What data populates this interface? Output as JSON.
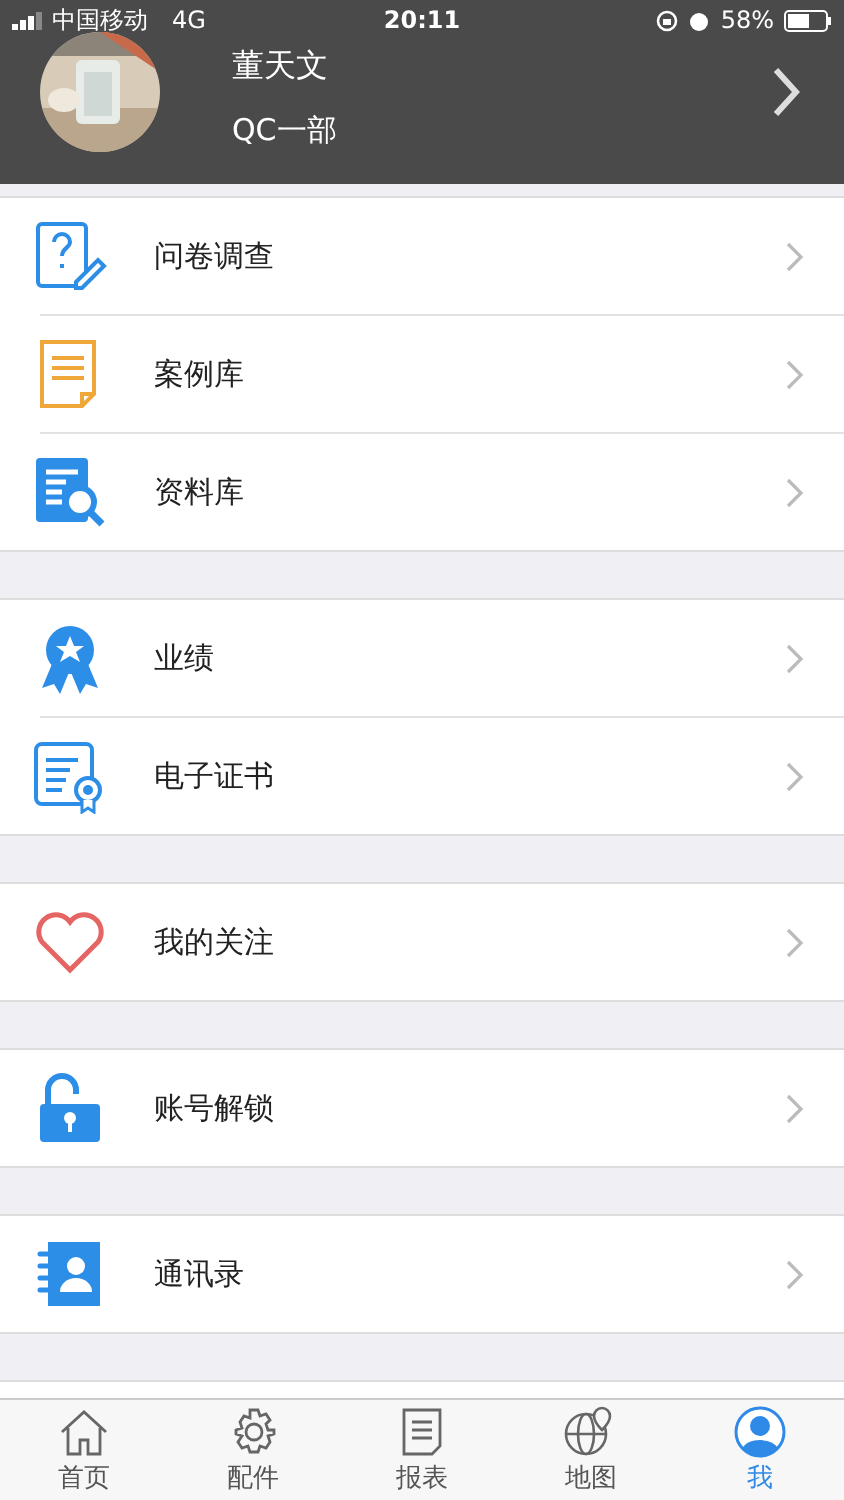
{
  "status_bar": {
    "carrier": "中国移动",
    "network": "4G",
    "time": "20:11",
    "battery": "58%"
  },
  "profile": {
    "name": "董天文",
    "department": "QC一部"
  },
  "groups": [
    {
      "items": [
        {
          "label": "问卷调查",
          "kind": "survey"
        },
        {
          "label": "案例库",
          "kind": "document"
        },
        {
          "label": "资料库",
          "kind": "search"
        }
      ]
    },
    {
      "items": [
        {
          "label": "业绩",
          "kind": "award"
        },
        {
          "label": "电子证书",
          "kind": "certificate"
        }
      ]
    },
    {
      "items": [
        {
          "label": "我的关注",
          "kind": "heart"
        }
      ]
    },
    {
      "items": [
        {
          "label": "账号解锁",
          "kind": "unlock"
        }
      ]
    },
    {
      "items": [
        {
          "label": "通讯录",
          "kind": "contacts"
        }
      ]
    }
  ],
  "tab_bar": [
    {
      "label": "首页",
      "kind": "home",
      "selected": false
    },
    {
      "label": "配件",
      "kind": "gear",
      "selected": false
    },
    {
      "label": "报表",
      "kind": "report",
      "selected": false
    },
    {
      "label": "地图",
      "kind": "globe",
      "selected": false
    },
    {
      "label": "我",
      "kind": "user",
      "selected": true
    }
  ]
}
